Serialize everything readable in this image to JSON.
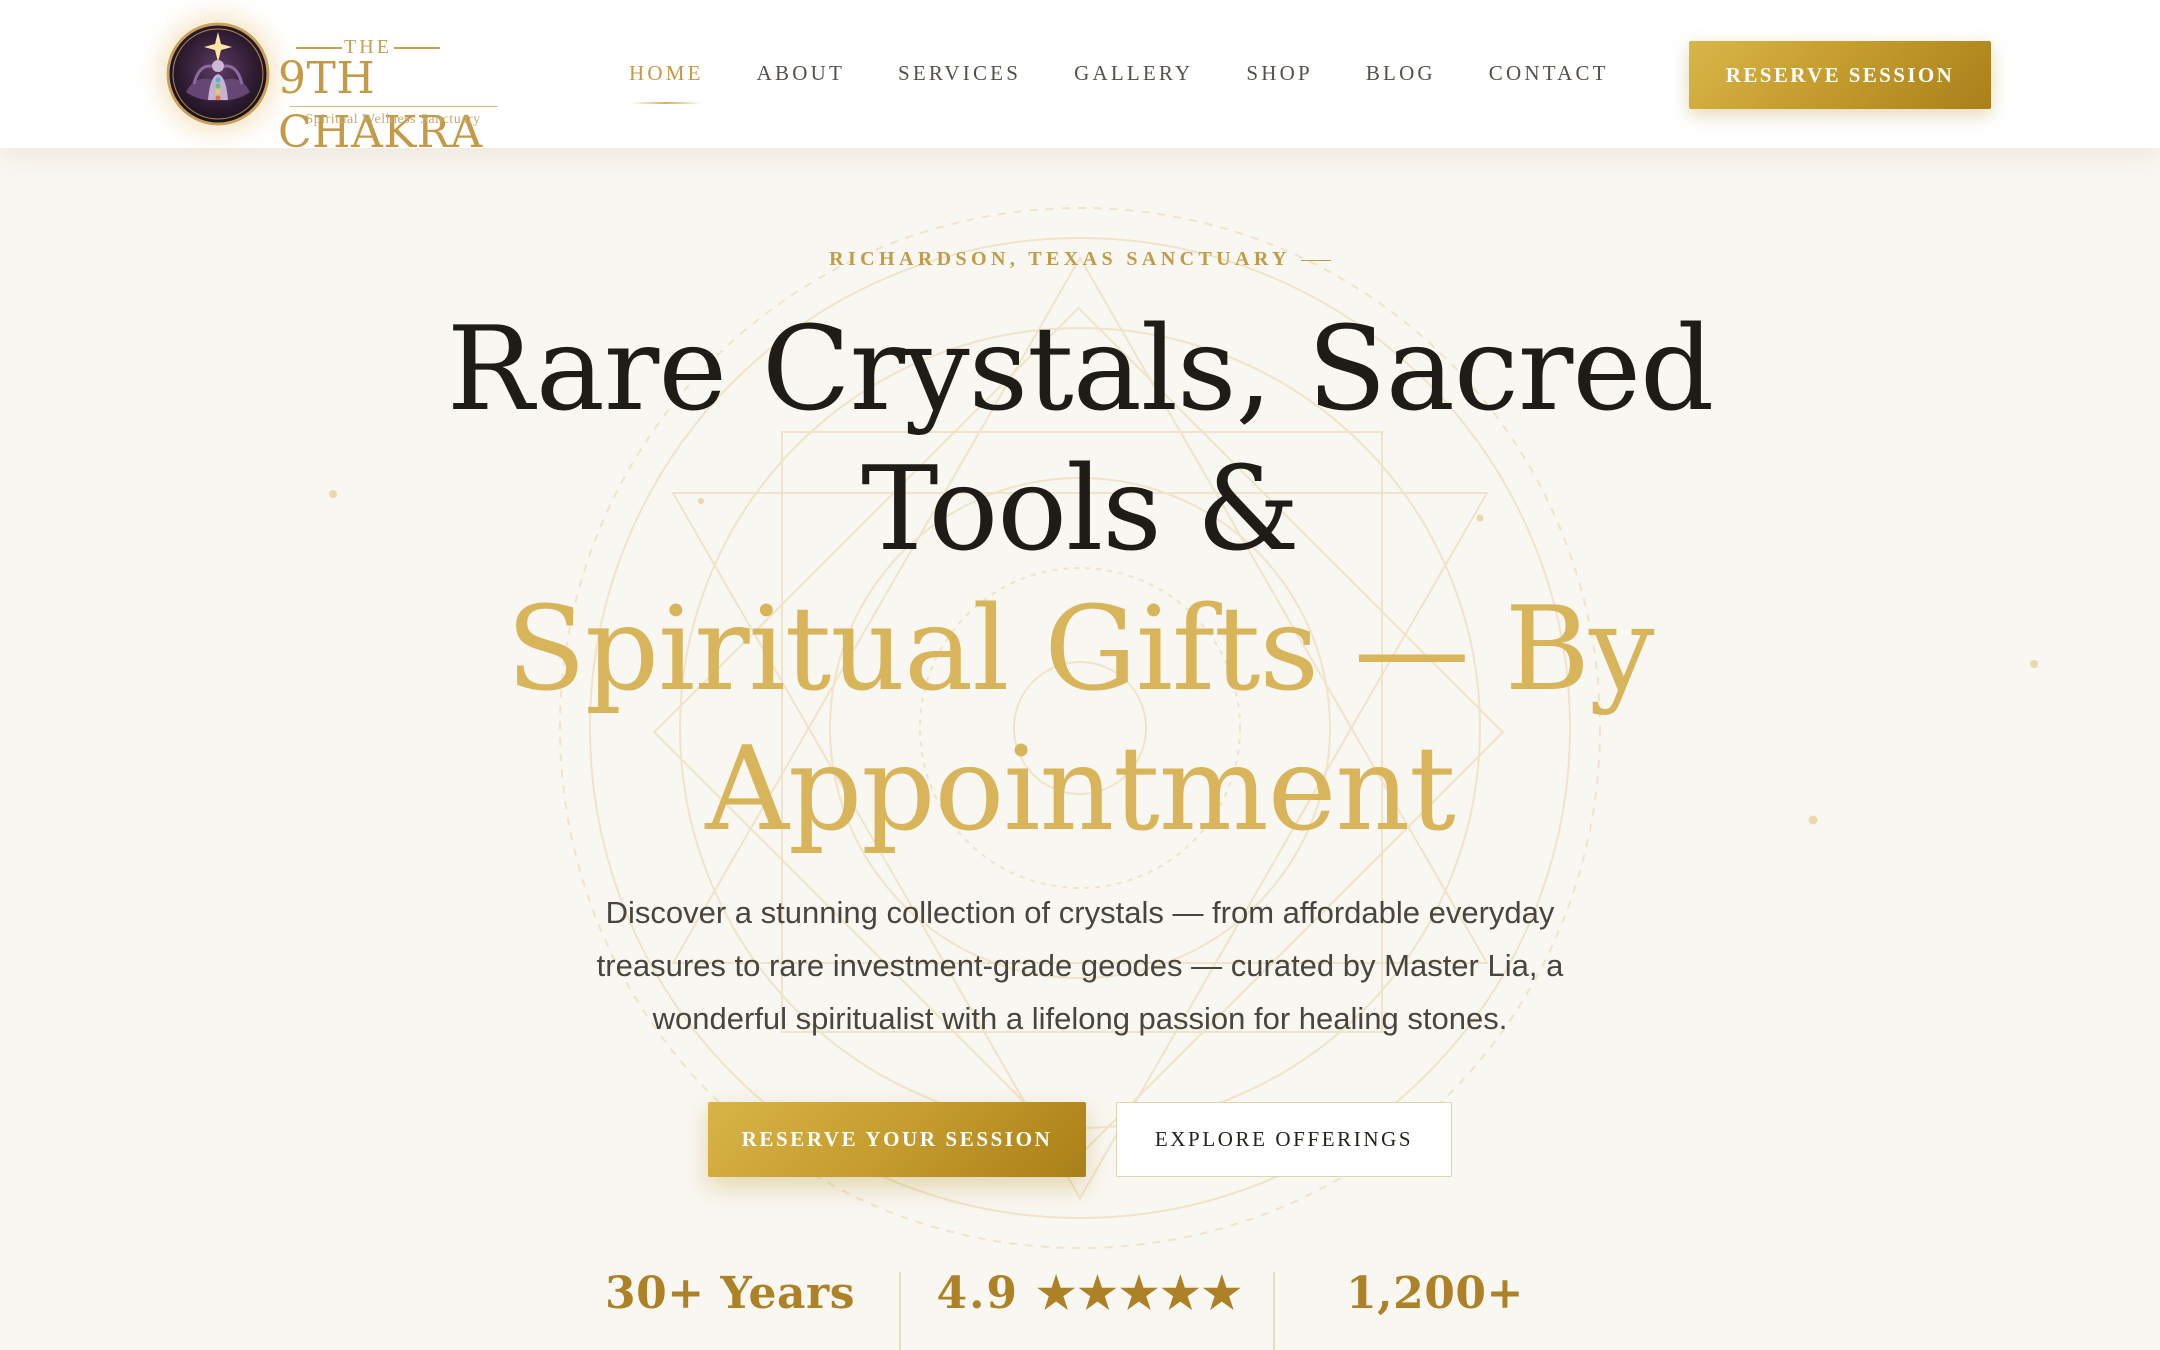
{
  "header": {
    "logo": {
      "the": "THE",
      "name": "9TH CHAKRA",
      "tagline": "Spiritual Wellness Sanctuary"
    },
    "nav": [
      {
        "label": "HOME",
        "active": true
      },
      {
        "label": "ABOUT",
        "active": false
      },
      {
        "label": "SERVICES",
        "active": false
      },
      {
        "label": "GALLERY",
        "active": false
      },
      {
        "label": "SHOP",
        "active": false
      },
      {
        "label": "BLOG",
        "active": false
      },
      {
        "label": "CONTACT",
        "active": false
      }
    ],
    "cta_label": "RESERVE SESSION"
  },
  "hero": {
    "kicker": "RICHARDSON, TEXAS SANCTUARY",
    "headline_dark_1": "Rare Crystals, Sacred",
    "headline_dark_2": "Tools &",
    "headline_gold_1": "Spiritual Gifts — By",
    "headline_gold_2": "Appointment",
    "lede": "Discover a stunning collection of crystals — from affordable everyday treasures to rare investment-grade geodes — curated by Master Lia, a wonderful spiritualist with a lifelong passion for healing stones.",
    "primary_button": "RESERVE YOUR SESSION",
    "secondary_button": "EXPLORE OFFERINGS"
  },
  "stats": [
    {
      "value": "30+ Years"
    },
    {
      "value": "4.9 ★★★★★"
    },
    {
      "value": "1,200+"
    }
  ],
  "colors": {
    "gold": "#c29a45",
    "gold_light": "#d8b45a",
    "background": "#f9f7f2",
    "text_dark": "#1f1c18"
  },
  "icons": {
    "logo_emblem": "meditating-figure-lotus-icon"
  }
}
